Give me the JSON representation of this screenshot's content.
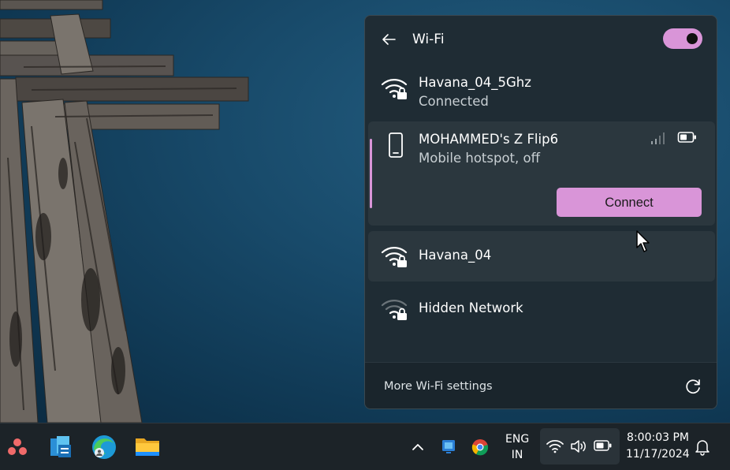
{
  "wifi_panel": {
    "title": "Wi-Fi",
    "toggle_state": "on",
    "networks": [
      {
        "name": "Havana_04_5Ghz",
        "status": "Connected",
        "icon": "wifi-lock-icon"
      },
      {
        "name": "MOHAMMED's Z Flip6",
        "status": "Mobile hotspot, off",
        "icon": "phone-icon",
        "action_label": "Connect"
      },
      {
        "name": "Havana_04",
        "icon": "wifi-lock-icon"
      },
      {
        "name": "Hidden Network",
        "icon": "wifi-lock-icon"
      }
    ],
    "footer_link": "More Wi-Fi settings"
  },
  "taskbar": {
    "language_line1": "ENG",
    "language_line2": "IN",
    "time": "8:00:03 PM",
    "date": "11/17/2024"
  },
  "colors": {
    "accent": "#d995d8",
    "panel_bg": "#1f2c34",
    "item_bg": "#2b373e",
    "taskbar_bg": "#1c2328"
  }
}
